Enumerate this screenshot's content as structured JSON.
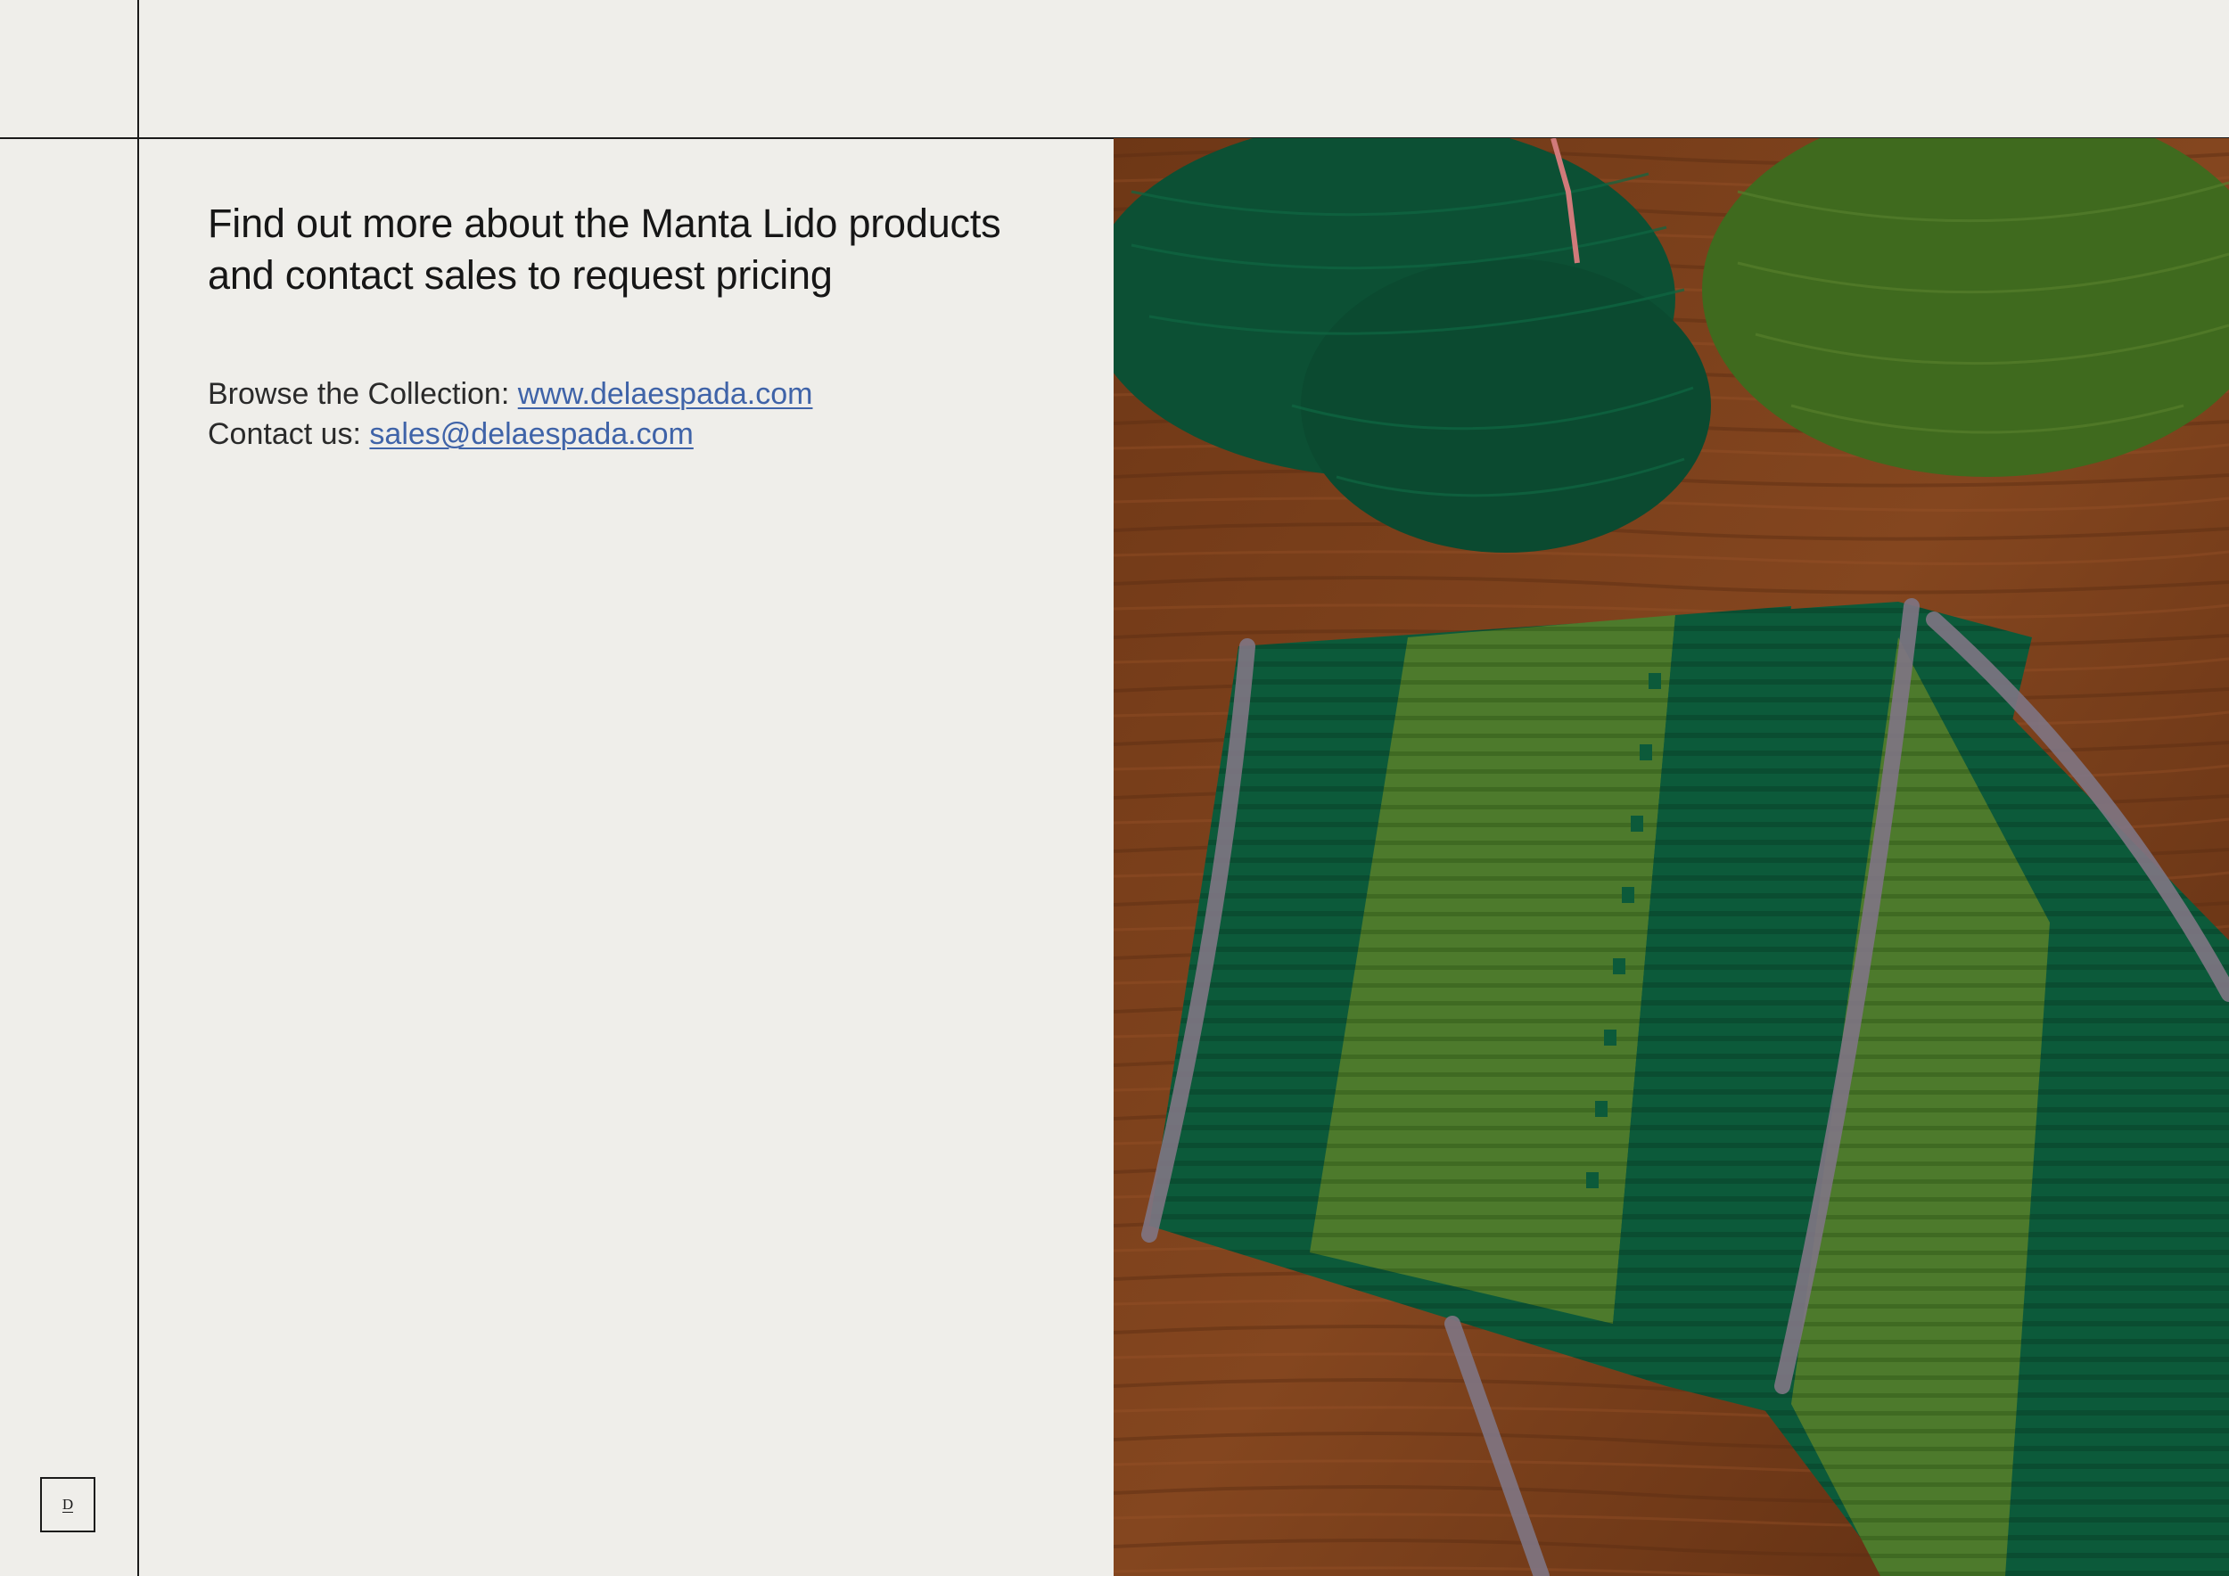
{
  "headline": {
    "line1": "Find out more about the Manta Lido products",
    "line2": "and contact sales to request pricing"
  },
  "links": {
    "browse_label": "Browse the Collection: ",
    "browse_link": "www.delaespada.com",
    "contact_label": "Contact us: ",
    "contact_link": "sales@delaespada.com"
  },
  "logo": {
    "mark": "D"
  },
  "photo": {
    "subject": "woven-rug-and-yarn-photo"
  }
}
